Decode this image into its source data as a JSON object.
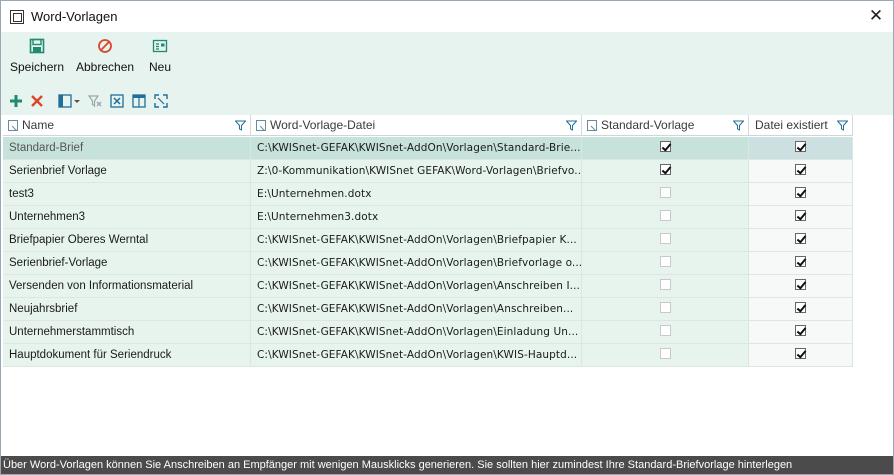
{
  "window": {
    "title": "Word-Vorlagen",
    "close_glyph": "✕"
  },
  "ribbon": {
    "buttons": [
      {
        "label": "Speichern",
        "icon": "save-icon"
      },
      {
        "label": "Abbrechen",
        "icon": "cancel-icon"
      },
      {
        "label": "Neu",
        "icon": "new-icon"
      }
    ]
  },
  "colors": {
    "accent": "#1f8b73",
    "cancel": "#d9462b",
    "ribbon_bg": "#e6f3ef",
    "row_bg": "#e7f4ee",
    "selected_bg": "#c7e2da",
    "status_bg": "#4b4b4b"
  },
  "grid": {
    "columns": [
      "Name",
      "Word-Vorlage-Datei",
      "Standard-Vorlage",
      "Datei existiert"
    ],
    "rows": [
      {
        "name": "Standard-Brief",
        "file": "C:\\KWISnet-GEFAK\\KWISnet-AddOn\\Vorlagen\\Standard-Brie...",
        "standard": true,
        "exists": true,
        "selected": true
      },
      {
        "name": "Serienbrief Vorlage",
        "file": "Z:\\0-Kommunikation\\KWISnet  GEFAK\\Word-Vorlagen\\Briefvo...",
        "standard": true,
        "exists": true,
        "selected": false
      },
      {
        "name": "test3",
        "file": "E:\\Unternehmen.dotx",
        "standard": false,
        "exists": true,
        "selected": false
      },
      {
        "name": "Unternehmen3",
        "file": "E:\\Unternehmen3.dotx",
        "standard": false,
        "exists": true,
        "selected": false
      },
      {
        "name": "Briefpapier Oberes Werntal",
        "file": "C:\\KWISnet-GEFAK\\KWISnet-AddOn\\Vorlagen\\Briefpapier  K...",
        "standard": false,
        "exists": true,
        "selected": false
      },
      {
        "name": "Serienbrief-Vorlage",
        "file": "C:\\KWISnet-GEFAK\\KWISnet-AddOn\\Vorlagen\\Briefvorlage  o...",
        "standard": false,
        "exists": true,
        "selected": false
      },
      {
        "name": "Versenden von Informationsmaterial",
        "file": "C:\\KWISnet-GEFAK\\KWISnet-AddOn\\Vorlagen\\Anschreiben  I...",
        "standard": false,
        "exists": true,
        "selected": false
      },
      {
        "name": "Neujahrsbrief",
        "file": "C:\\KWISnet-GEFAK\\KWISnet-AddOn\\Vorlagen\\Anschreiben...",
        "standard": false,
        "exists": true,
        "selected": false
      },
      {
        "name": "Unternehmerstammtisch",
        "file": "C:\\KWISnet-GEFAK\\KWISnet-AddOn\\Vorlagen\\Einladung  Un...",
        "standard": false,
        "exists": true,
        "selected": false
      },
      {
        "name": "Hauptdokument für Seriendruck",
        "file": "C:\\KWISnet-GEFAK\\KWISnet-AddOn\\Vorlagen\\KWIS-Hauptd...",
        "standard": false,
        "exists": true,
        "selected": false
      }
    ]
  },
  "status": {
    "text": "Über Word-Vorlagen können Sie Anschreiben an Empfänger mit wenigen Mausklicks generieren. Sie sollten hier zumindest Ihre Standard-Briefvorlage hinterlegen"
  }
}
